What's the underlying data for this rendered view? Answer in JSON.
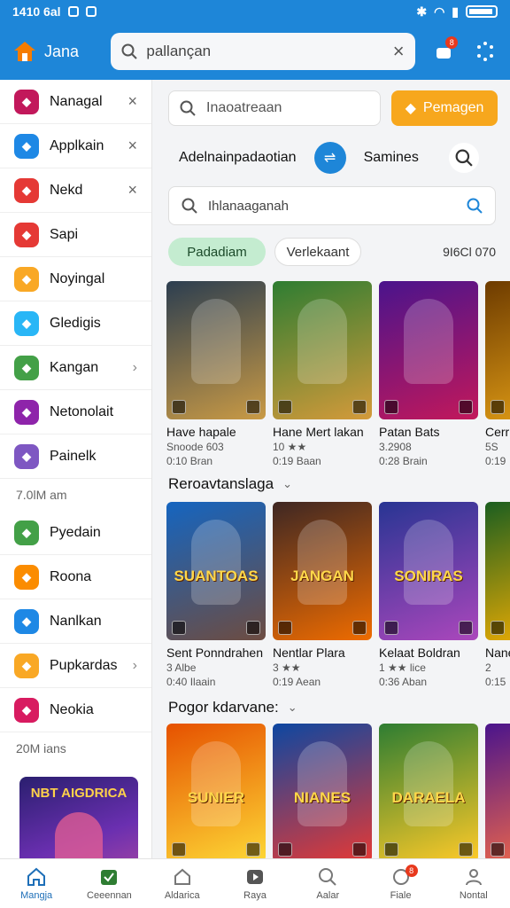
{
  "status_bar": {
    "time": "1410 6al"
  },
  "header": {
    "app_title": "Jana",
    "search_value": "pallançan",
    "notif_count": "8"
  },
  "sidebar": {
    "items": [
      {
        "label": "Nanagal",
        "trailing": "×",
        "color": "#c2185b"
      },
      {
        "label": "Applkain",
        "trailing": "×",
        "color": "#1e88e5"
      },
      {
        "label": "Nekd",
        "trailing": "×",
        "color": "#e53935"
      },
      {
        "label": "Sapi",
        "trailing": "",
        "color": "#e53935"
      },
      {
        "label": "Noyingal",
        "trailing": "",
        "color": "#f9a825"
      },
      {
        "label": "Gledigis",
        "trailing": "",
        "color": "#29b6f6"
      },
      {
        "label": "Kangan",
        "trailing": "›",
        "color": "#43a047"
      },
      {
        "label": "Netonolait",
        "trailing": "",
        "color": "#8e24aa"
      },
      {
        "label": "Painelk",
        "trailing": "",
        "color": "#7e57c2"
      }
    ],
    "time_1": "7.0lM am",
    "items_2": [
      {
        "label": "Pyedain",
        "trailing": "",
        "color": "#43a047"
      },
      {
        "label": "Roona",
        "trailing": "",
        "color": "#fb8c00"
      },
      {
        "label": "Nanlkan",
        "trailing": "",
        "color": "#1e88e5"
      },
      {
        "label": "Pupkardas",
        "trailing": "›",
        "color": "#f9a825"
      },
      {
        "label": "Neokia",
        "trailing": "",
        "color": "#d81b60"
      }
    ],
    "time_2": "20M ians",
    "banner_title": "NBT AIGDRICA"
  },
  "main": {
    "top_search_placeholder": "Inaoatreaan",
    "promo_label": "Pemagen",
    "category_left": "Adelnainpadaotian",
    "category_right": "Samines",
    "secondary_search_placeholder": "Ihlanaaganah",
    "chips": [
      "Padadiam",
      "Verlekaant"
    ],
    "result_count": "9I6Cl 070",
    "row1": [
      {
        "title": "Have hapale",
        "sub": "Snoode  603",
        "meta": "0:10 Bran",
        "c1": "#2c3e50",
        "c2": "#c99a45"
      },
      {
        "title": "Hane Mert lakan",
        "sub": "10 ★★",
        "meta": "0:19 Baan",
        "c1": "#2e7d32",
        "c2": "#d49a3a"
      },
      {
        "title": "Patan Bats",
        "sub": "3.2908",
        "meta": "0:28 Brain",
        "c1": "#4a148c",
        "c2": "#c2185b"
      },
      {
        "title": "Cerr",
        "sub": "5S",
        "meta": "0:19",
        "c1": "#6d3b00",
        "c2": "#e8a317"
      }
    ],
    "section2_title": "Reroavtanslaga",
    "row2": [
      {
        "title": "Sent Ponndrahen",
        "sub": "3 Albe",
        "meta": "0:40 Ilaain",
        "art": "SUANTOAS",
        "c1": "#1565c0",
        "c2": "#6d4c41"
      },
      {
        "title": "Nentlar Plara",
        "sub": "3 ★★",
        "meta": "0:19 Aean",
        "art": "JANGAN",
        "c1": "#3e2723",
        "c2": "#ef6c00"
      },
      {
        "title": "Kelaat Boldran",
        "sub": "1 ★★ lice",
        "meta": "0:36 Aban",
        "art": "SONIRAS",
        "c1": "#283593",
        "c2": "#ab47bc"
      },
      {
        "title": "Nane",
        "sub": "2",
        "meta": "0:15",
        "art": "",
        "c1": "#1b5e20",
        "c2": "#ffb300"
      }
    ],
    "section3_title": "Pogor kdarvane:",
    "row3": [
      {
        "art": "SUNIER",
        "c1": "#e65100",
        "c2": "#fdd835"
      },
      {
        "art": "NIANES",
        "c1": "#0d47a1",
        "c2": "#e53935"
      },
      {
        "art": "DARAELA",
        "c1": "#2e7d32",
        "c2": "#ffca28"
      },
      {
        "art": "",
        "c1": "#4a148c",
        "c2": "#ff7043"
      }
    ]
  },
  "bottom_nav": [
    {
      "label": "Mangja",
      "icon": "home-icon",
      "active": true
    },
    {
      "label": "Ceeennan",
      "icon": "checklist-icon",
      "active": false
    },
    {
      "label": "Aldarica",
      "icon": "house-outline-icon",
      "active": false
    },
    {
      "label": "Raya",
      "icon": "play-store-icon",
      "active": false
    },
    {
      "label": "Aalar",
      "icon": "search-icon",
      "active": false
    },
    {
      "label": "Fiale",
      "icon": "refresh-icon",
      "active": false,
      "badge": "8"
    },
    {
      "label": "Nontal",
      "icon": "profile-icon",
      "active": false
    }
  ],
  "colors": {
    "primary": "#1e86d8",
    "promo": "#f7a71d",
    "chip_active": "#c4ecd0"
  }
}
